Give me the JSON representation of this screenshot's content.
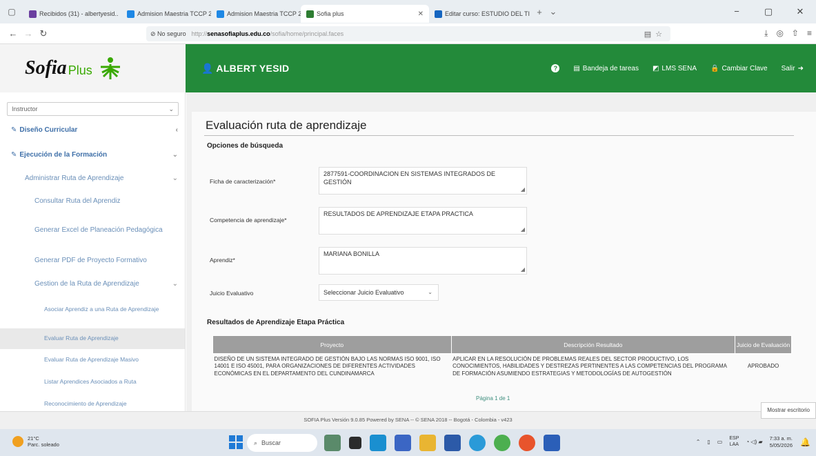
{
  "browser": {
    "tabs": [
      {
        "label": "Recibidos (31) - albertyesid..",
        "color": "#6b3fa0",
        "active": false
      },
      {
        "label": "Admision Maestria TCCP 202",
        "color": "#1e88e5",
        "active": false
      },
      {
        "label": "Admision Maestria TCCP 202",
        "color": "#1e88e5",
        "active": false
      },
      {
        "label": "Sofia plus",
        "color": "#2e7d32",
        "active": true
      },
      {
        "label": "Editar curso: ESTUDIO DEL TI",
        "color": "#1565c0",
        "active": false
      }
    ],
    "security_label": "No seguro",
    "url_prefix": "http://",
    "url_host": "senasofiaplus.edu.co",
    "url_path": "/sofia/home/principal.faces"
  },
  "header": {
    "logo_text": "Sofia",
    "logo_plus": "Plus",
    "user_name": "ALBERT YESID",
    "menu": {
      "tasks": "Bandeja de tareas",
      "lms": "LMS SENA",
      "change_password": "Cambiar Clave",
      "logout": "Salir"
    }
  },
  "sidebar": {
    "role": "Instructor",
    "items": [
      {
        "label": "Diseño Curricular"
      },
      {
        "label": "Ejecución de la Formación"
      },
      {
        "label": "Administrar Ruta de Aprendizaje"
      },
      {
        "label": "Consultar Ruta del Aprendiz"
      },
      {
        "label": "Generar Excel de Planeación Pedagógica"
      },
      {
        "label": "Generar PDF de Proyecto Formativo"
      },
      {
        "label": "Gestion de la Ruta de Aprendizaje"
      },
      {
        "label": "Asociar Aprendiz a una Ruta de Aprendizaje"
      },
      {
        "label": "Evaluar Ruta de Aprendizaje"
      },
      {
        "label": "Evaluar Ruta de Aprendizaje Masivo"
      },
      {
        "label": "Listar Aprendices Asociados a Ruta"
      },
      {
        "label": "Reconocimiento de Aprendizaje"
      }
    ]
  },
  "main": {
    "title": "Evaluación ruta de aprendizaje",
    "search_options": "Opciones de búsqueda",
    "fields": {
      "ficha_label": "Ficha de caracterización*",
      "ficha_value": "2877591-COORDINACION EN SISTEMAS INTEGRADOS DE GESTIÓN",
      "competencia_label": "Competencia de aprendizaje*",
      "competencia_value": "RESULTADOS DE APRENDIZAJE ETAPA PRACTICA",
      "aprendiz_label": "Aprendiz*",
      "aprendiz_value": "MARIANA BONILLA",
      "juicio_label": "Juicio Evaluativo",
      "juicio_value": "Seleccionar Juicio Evaluativo"
    },
    "results_title": "Resultados de Aprendizaje Etapa Práctica",
    "table": {
      "headers": [
        "Proyecto",
        "Descripción Resultado",
        "Juicio de Evaluación"
      ],
      "rows": [
        {
          "proyecto": "DISEÑO DE UN SISTEMA INTEGRADO DE GESTIÓN BAJO LAS NORMAS ISO 9001, ISO 14001 E ISO 45001, PARA ORGANIZACIONES DE DIFERENTES ACTIVIDADES ECONÓMICAS EN EL DEPARTAMENTO DEL CUNDINAMARCA",
          "descripcion": "APLICAR EN LA RESOLUCIÓN DE PROBLEMAS REALES DEL SECTOR PRODUCTIVO, LOS CONOCIMIENTOS, HABILIDADES Y DESTREZAS PERTINENTES A LAS COMPETENCIAS DEL PROGRAMA DE FORMACIÓN ASUMIENDO ESTRATEGIAS Y METODOLOGÍAS DE AUTOGESTIÓN",
          "juicio": "APROBADO"
        }
      ]
    },
    "pager": "Página 1 de 1"
  },
  "footer": {
    "text": "SOFIA Plus Versión 9.0.85 Powered by SENA -- © SENA 2018 -- Bogotá - Colombia - v423",
    "desk_toast": "Mostrar escritorio"
  },
  "taskbar": {
    "weather_temp": "21°C",
    "weather_desc": "Parc. soleado",
    "search_placeholder": "Buscar",
    "lang_top": "ESP",
    "lang_bottom": "LAA",
    "time": "7:33 a. m.",
    "date": "5/05/2026"
  }
}
